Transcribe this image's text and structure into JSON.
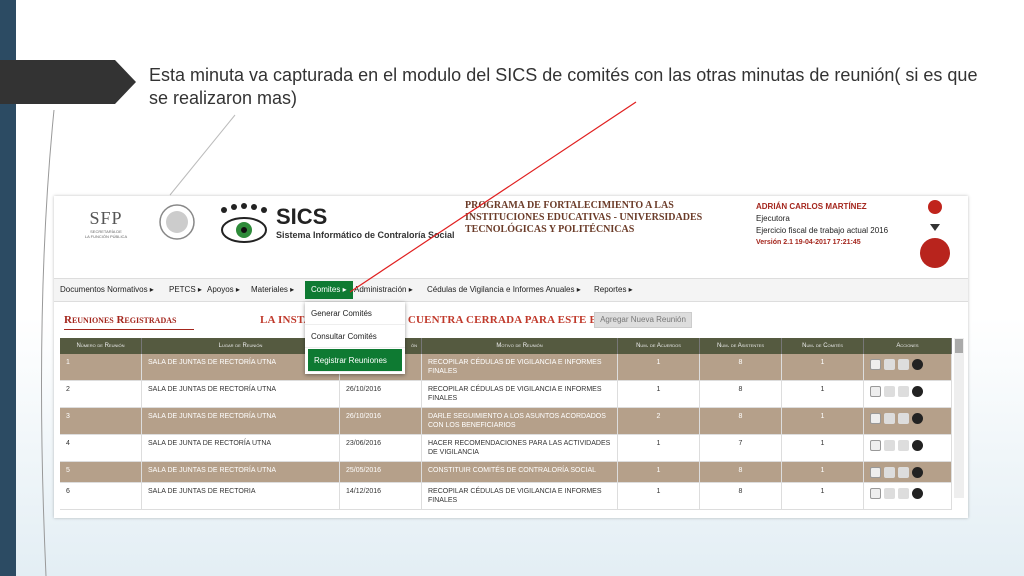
{
  "slide": {
    "bullet_text": "Esta minuta va capturada en el modulo del SICS de comités  con las otras minutas de reunión( si es que se realizaron mas)"
  },
  "header": {
    "sfp_logo": "SFP",
    "sfp_sub1": "SECRETARÍA DE",
    "sfp_sub2": "LA FUNCIÓN PÚBLICA",
    "sics_title": "SICS",
    "sics_subtitle": "Sistema Informático de Contraloría Social",
    "program_line1": "PROGRAMA DE FORTALECIMIENTO A LAS",
    "program_line2": "INSTITUCIONES EDUCATIVAS - UNIVERSIDADES",
    "program_line3": "TECNOLÓGICAS Y POLITÉCNICAS",
    "user_name": "ADRIÁN CARLOS MARTÍNEZ",
    "user_role": "Ejecutora",
    "fiscal_year": "Ejercicio fiscal de trabajo actual  2016",
    "version": "Versión 2.1   19-04-2017 17:21:45"
  },
  "nav": {
    "items": [
      {
        "label": "Documentos Normativos ▸"
      },
      {
        "label": "PETCS ▸"
      },
      {
        "label": "Apoyos ▸"
      },
      {
        "label": "Materiales ▸"
      },
      {
        "label": "Comites ▸"
      },
      {
        "label": "Administración ▸"
      },
      {
        "label": "Cédulas de Vigilancia e Informes Anuales ▸"
      },
      {
        "label": "Reportes ▸"
      }
    ]
  },
  "dropdown": {
    "items": [
      {
        "label": "Generar Comités"
      },
      {
        "label": "Consultar Comités"
      },
      {
        "label": "Registrar Reuniones"
      }
    ]
  },
  "section": {
    "title": "Reuniones Registradas",
    "status_message": "LA INSTA",
    "status_message_end": "CUENTRA CERRADA PARA ESTE EJERCICIO",
    "add_button": "Agregar Nueva Reunión"
  },
  "table": {
    "headers": [
      "Número de Reunión",
      "Lugar de Reunión",
      "",
      "Motivo de Reunión",
      "Num. de Acuerdos",
      "Num. de Asistentes",
      "Num. de Comités",
      "Acciones"
    ],
    "header_fecha_fragment": "ón",
    "rows": [
      {
        "num": "1",
        "lugar": "SALA DE JUNTAS DE RECTORÍA UTNA",
        "fecha": "",
        "motivo": "RECOPILAR CÉDULAS DE VIGILANCIA E INFORMES FINALES",
        "acuerdos": "1",
        "asistentes": "8",
        "comites": "1"
      },
      {
        "num": "2",
        "lugar": "SALA DE JUNTAS DE RECTORÍA UTNA",
        "fecha": "26/10/2016",
        "motivo": "RECOPILAR CÉDULAS DE VIGILANCIA E INFORMES FINALES",
        "acuerdos": "1",
        "asistentes": "8",
        "comites": "1"
      },
      {
        "num": "3",
        "lugar": "SALA DE JUNTAS DE RECTORÍA UTNA",
        "fecha": "26/10/2016",
        "motivo": "DARLE SEGUIMIENTO A LOS ASUNTOS ACORDADOS CON LOS BENEFICIARIOS",
        "acuerdos": "2",
        "asistentes": "8",
        "comites": "1"
      },
      {
        "num": "4",
        "lugar": "SALA DE JUNTA DE RECTORÍA UTNA",
        "fecha": "23/06/2016",
        "motivo": "HACER RECOMENDACIONES PARA LAS ACTIVIDADES DE VIGILANCIA",
        "acuerdos": "1",
        "asistentes": "7",
        "comites": "1"
      },
      {
        "num": "5",
        "lugar": "SALA DE JUNTAS DE RECTORÍA UTNA",
        "fecha": "25/05/2016",
        "motivo": "CONSTITUIR COMITÉS DE CONTRALORÍA SOCIAL",
        "acuerdos": "1",
        "asistentes": "8",
        "comites": "1"
      },
      {
        "num": "6",
        "lugar": "SALA DE JUNTAS DE RECTORIA",
        "fecha": "14/12/2016",
        "motivo": "RECOPILAR CÉDULAS DE VIGILANCIA E INFORMES FINALES",
        "acuerdos": "1",
        "asistentes": "8",
        "comites": "1"
      }
    ]
  },
  "colors": {
    "accent_green": "#0e7a32",
    "title_red": "#a4261d",
    "row_odd": "#b5a08a",
    "header_dark": "#555a40"
  }
}
